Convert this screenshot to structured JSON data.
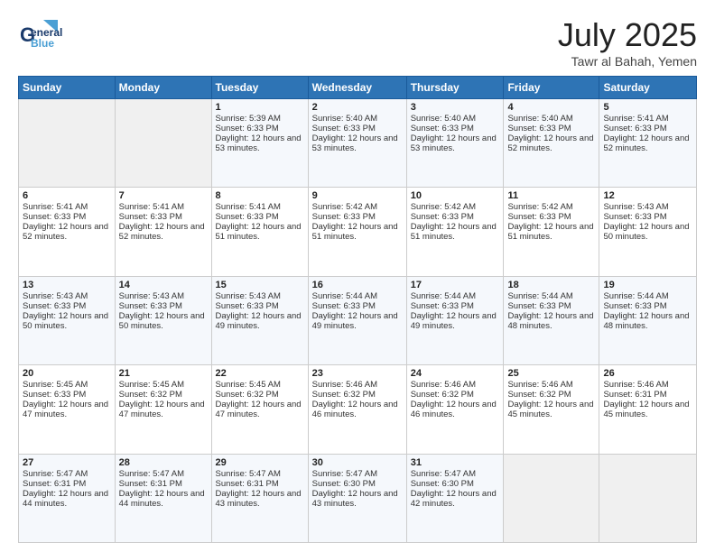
{
  "header": {
    "logo_general": "General",
    "logo_blue": "Blue",
    "month_title": "July 2025",
    "location": "Tawr al Bahah, Yemen"
  },
  "weekdays": [
    "Sunday",
    "Monday",
    "Tuesday",
    "Wednesday",
    "Thursday",
    "Friday",
    "Saturday"
  ],
  "weeks": [
    [
      {
        "day": "",
        "sunrise": "",
        "sunset": "",
        "daylight": ""
      },
      {
        "day": "",
        "sunrise": "",
        "sunset": "",
        "daylight": ""
      },
      {
        "day": "1",
        "sunrise": "Sunrise: 5:39 AM",
        "sunset": "Sunset: 6:33 PM",
        "daylight": "Daylight: 12 hours and 53 minutes."
      },
      {
        "day": "2",
        "sunrise": "Sunrise: 5:40 AM",
        "sunset": "Sunset: 6:33 PM",
        "daylight": "Daylight: 12 hours and 53 minutes."
      },
      {
        "day": "3",
        "sunrise": "Sunrise: 5:40 AM",
        "sunset": "Sunset: 6:33 PM",
        "daylight": "Daylight: 12 hours and 53 minutes."
      },
      {
        "day": "4",
        "sunrise": "Sunrise: 5:40 AM",
        "sunset": "Sunset: 6:33 PM",
        "daylight": "Daylight: 12 hours and 52 minutes."
      },
      {
        "day": "5",
        "sunrise": "Sunrise: 5:41 AM",
        "sunset": "Sunset: 6:33 PM",
        "daylight": "Daylight: 12 hours and 52 minutes."
      }
    ],
    [
      {
        "day": "6",
        "sunrise": "Sunrise: 5:41 AM",
        "sunset": "Sunset: 6:33 PM",
        "daylight": "Daylight: 12 hours and 52 minutes."
      },
      {
        "day": "7",
        "sunrise": "Sunrise: 5:41 AM",
        "sunset": "Sunset: 6:33 PM",
        "daylight": "Daylight: 12 hours and 52 minutes."
      },
      {
        "day": "8",
        "sunrise": "Sunrise: 5:41 AM",
        "sunset": "Sunset: 6:33 PM",
        "daylight": "Daylight: 12 hours and 51 minutes."
      },
      {
        "day": "9",
        "sunrise": "Sunrise: 5:42 AM",
        "sunset": "Sunset: 6:33 PM",
        "daylight": "Daylight: 12 hours and 51 minutes."
      },
      {
        "day": "10",
        "sunrise": "Sunrise: 5:42 AM",
        "sunset": "Sunset: 6:33 PM",
        "daylight": "Daylight: 12 hours and 51 minutes."
      },
      {
        "day": "11",
        "sunrise": "Sunrise: 5:42 AM",
        "sunset": "Sunset: 6:33 PM",
        "daylight": "Daylight: 12 hours and 51 minutes."
      },
      {
        "day": "12",
        "sunrise": "Sunrise: 5:43 AM",
        "sunset": "Sunset: 6:33 PM",
        "daylight": "Daylight: 12 hours and 50 minutes."
      }
    ],
    [
      {
        "day": "13",
        "sunrise": "Sunrise: 5:43 AM",
        "sunset": "Sunset: 6:33 PM",
        "daylight": "Daylight: 12 hours and 50 minutes."
      },
      {
        "day": "14",
        "sunrise": "Sunrise: 5:43 AM",
        "sunset": "Sunset: 6:33 PM",
        "daylight": "Daylight: 12 hours and 50 minutes."
      },
      {
        "day": "15",
        "sunrise": "Sunrise: 5:43 AM",
        "sunset": "Sunset: 6:33 PM",
        "daylight": "Daylight: 12 hours and 49 minutes."
      },
      {
        "day": "16",
        "sunrise": "Sunrise: 5:44 AM",
        "sunset": "Sunset: 6:33 PM",
        "daylight": "Daylight: 12 hours and 49 minutes."
      },
      {
        "day": "17",
        "sunrise": "Sunrise: 5:44 AM",
        "sunset": "Sunset: 6:33 PM",
        "daylight": "Daylight: 12 hours and 49 minutes."
      },
      {
        "day": "18",
        "sunrise": "Sunrise: 5:44 AM",
        "sunset": "Sunset: 6:33 PM",
        "daylight": "Daylight: 12 hours and 48 minutes."
      },
      {
        "day": "19",
        "sunrise": "Sunrise: 5:44 AM",
        "sunset": "Sunset: 6:33 PM",
        "daylight": "Daylight: 12 hours and 48 minutes."
      }
    ],
    [
      {
        "day": "20",
        "sunrise": "Sunrise: 5:45 AM",
        "sunset": "Sunset: 6:33 PM",
        "daylight": "Daylight: 12 hours and 47 minutes."
      },
      {
        "day": "21",
        "sunrise": "Sunrise: 5:45 AM",
        "sunset": "Sunset: 6:32 PM",
        "daylight": "Daylight: 12 hours and 47 minutes."
      },
      {
        "day": "22",
        "sunrise": "Sunrise: 5:45 AM",
        "sunset": "Sunset: 6:32 PM",
        "daylight": "Daylight: 12 hours and 47 minutes."
      },
      {
        "day": "23",
        "sunrise": "Sunrise: 5:46 AM",
        "sunset": "Sunset: 6:32 PM",
        "daylight": "Daylight: 12 hours and 46 minutes."
      },
      {
        "day": "24",
        "sunrise": "Sunrise: 5:46 AM",
        "sunset": "Sunset: 6:32 PM",
        "daylight": "Daylight: 12 hours and 46 minutes."
      },
      {
        "day": "25",
        "sunrise": "Sunrise: 5:46 AM",
        "sunset": "Sunset: 6:32 PM",
        "daylight": "Daylight: 12 hours and 45 minutes."
      },
      {
        "day": "26",
        "sunrise": "Sunrise: 5:46 AM",
        "sunset": "Sunset: 6:31 PM",
        "daylight": "Daylight: 12 hours and 45 minutes."
      }
    ],
    [
      {
        "day": "27",
        "sunrise": "Sunrise: 5:47 AM",
        "sunset": "Sunset: 6:31 PM",
        "daylight": "Daylight: 12 hours and 44 minutes."
      },
      {
        "day": "28",
        "sunrise": "Sunrise: 5:47 AM",
        "sunset": "Sunset: 6:31 PM",
        "daylight": "Daylight: 12 hours and 44 minutes."
      },
      {
        "day": "29",
        "sunrise": "Sunrise: 5:47 AM",
        "sunset": "Sunset: 6:31 PM",
        "daylight": "Daylight: 12 hours and 43 minutes."
      },
      {
        "day": "30",
        "sunrise": "Sunrise: 5:47 AM",
        "sunset": "Sunset: 6:30 PM",
        "daylight": "Daylight: 12 hours and 43 minutes."
      },
      {
        "day": "31",
        "sunrise": "Sunrise: 5:47 AM",
        "sunset": "Sunset: 6:30 PM",
        "daylight": "Daylight: 12 hours and 42 minutes."
      },
      {
        "day": "",
        "sunrise": "",
        "sunset": "",
        "daylight": ""
      },
      {
        "day": "",
        "sunrise": "",
        "sunset": "",
        "daylight": ""
      }
    ]
  ]
}
